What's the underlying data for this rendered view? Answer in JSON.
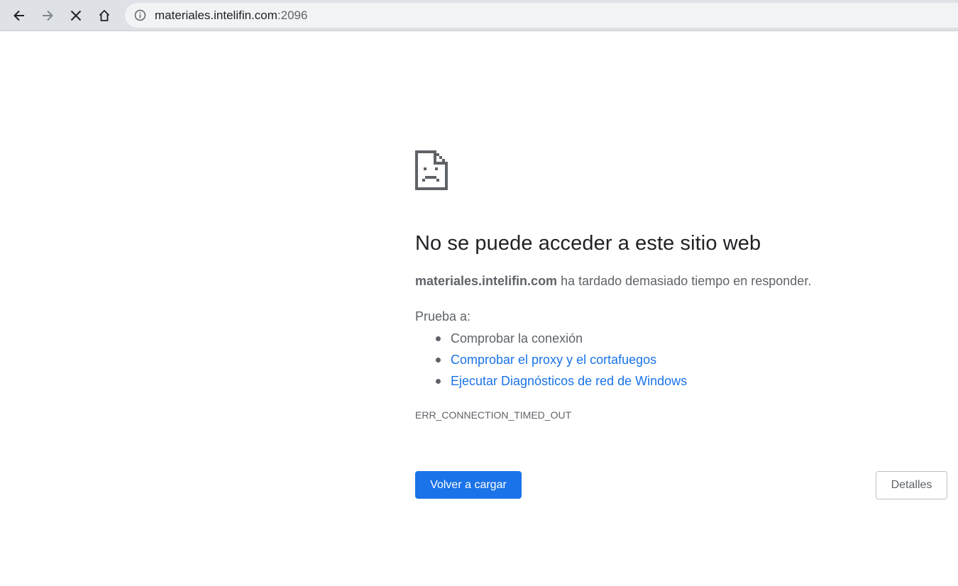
{
  "browser": {
    "icons": {
      "back": "arrow-left-icon",
      "forward": "arrow-right-icon",
      "stop": "close-icon",
      "home": "home-icon",
      "site_info": "info-circle-icon"
    },
    "url_host": "materiales.intelifin.com",
    "url_port": ":2096"
  },
  "error_page": {
    "icon": "sad-page-icon",
    "headline": "No se puede acceder a este sitio web",
    "summary_host": "materiales.intelifin.com",
    "summary_text": " ha tardado demasiado tiempo en responder.",
    "try_label": "Prueba a:",
    "suggestions": [
      {
        "label": "Comprobar la conexión",
        "is_link": false
      },
      {
        "label": "Comprobar el proxy y el cortafuegos",
        "is_link": true
      },
      {
        "label": "Ejecutar Diagnósticos de red de Windows",
        "is_link": true
      }
    ],
    "error_code": "ERR_CONNECTION_TIMED_OUT",
    "reload_label": "Volver a cargar",
    "details_label": "Detalles"
  },
  "colors": {
    "toolbar_bg": "#dee1e6",
    "omnibox_bg": "#f1f3f4",
    "link": "#1a73e8",
    "primary_button": "#1a73e8",
    "text_secondary": "#5f6368",
    "text_primary": "#202124"
  }
}
